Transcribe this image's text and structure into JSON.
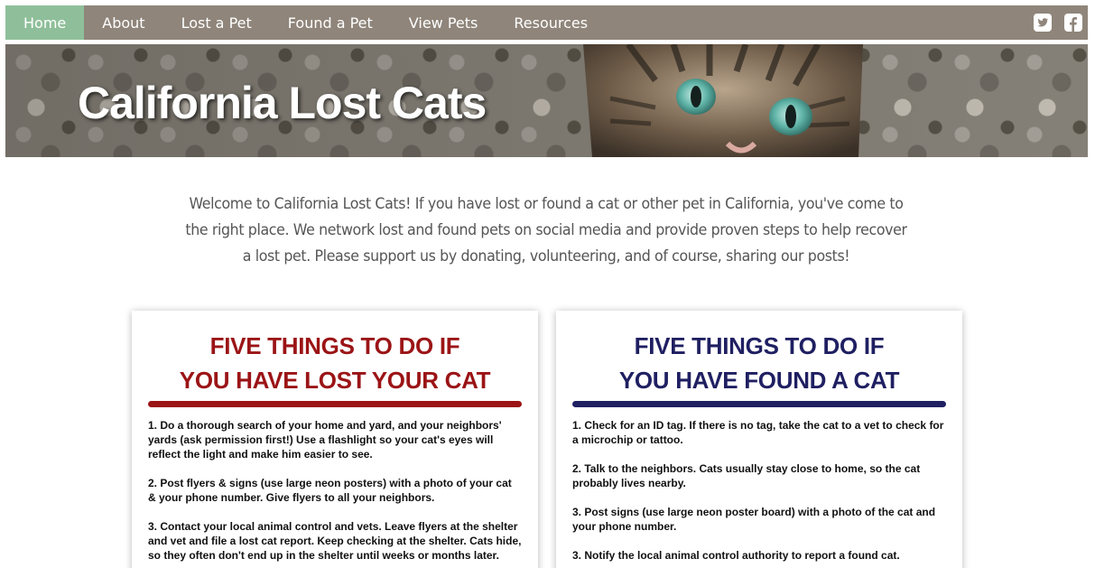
{
  "nav": {
    "items": [
      {
        "label": "Home",
        "active": true
      },
      {
        "label": "About"
      },
      {
        "label": "Lost a Pet"
      },
      {
        "label": "Found a Pet"
      },
      {
        "label": "View Pets"
      },
      {
        "label": "Resources"
      }
    ],
    "icons": [
      "twitter-icon",
      "facebook-icon"
    ]
  },
  "hero": {
    "title": "California Lost Cats"
  },
  "intro": {
    "text": "Welcome to California Lost Cats! If you have lost or found a cat or other pet in California, you've come to the right place. We network lost and found pets on social media and provide proven steps to help recover a lost pet. Please support us by donating, volunteering, and of course, sharing our posts!"
  },
  "cards": {
    "lost": {
      "title_line1": "FIVE THINGS TO DO IF",
      "title_line2": "YOU HAVE LOST YOUR CAT",
      "items": [
        "1. Do a thorough search of your home and yard, and your neighbors' yards (ask permission first!) Use a flashlight so your cat's eyes will reflect the light and make him easier to see.",
        "2. Post flyers & signs (use large neon posters) with a photo of your cat & your phone number. Give flyers to all your neighbors.",
        "3. Contact your local animal control and vets. Leave flyers at the shelter and vet and file a lost cat report. Keep checking at the shelter. Cats hide, so they often don't end up in the shelter until weeks or months later."
      ]
    },
    "found": {
      "title_line1": "FIVE THINGS TO DO IF",
      "title_line2": "YOU HAVE FOUND A CAT",
      "items": [
        "1. Check for an ID tag. If there is no tag, take the cat to a vet to check for a microchip or tattoo.",
        "2. Talk to the neighbors. Cats usually stay close to home, so the cat probably lives nearby.",
        "3. Post signs (use large neon poster board) with a photo of the cat and your phone number.",
        "3. Notify the local animal control authority to report a found cat."
      ]
    }
  },
  "colors": {
    "nav_bg": "#8f857a",
    "nav_active": "#8fbf9a",
    "lost_accent": "#9b1416",
    "found_accent": "#1f1f62",
    "intro_text": "#555555"
  }
}
